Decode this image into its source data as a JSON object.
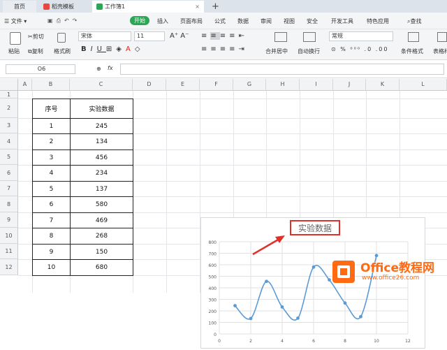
{
  "tabs": [
    {
      "label": "首页"
    },
    {
      "label": "稻壳模板"
    },
    {
      "label": "工作簿1"
    }
  ],
  "new_tab": "+",
  "menu": {
    "file": "文件",
    "start": "开始",
    "items": [
      "插入",
      "页面布局",
      "公式",
      "数据",
      "审阅",
      "视图",
      "安全",
      "开发工具",
      "特色应用"
    ],
    "search": "查找"
  },
  "ribbon": {
    "paste": "粘贴",
    "cut": "剪切",
    "copy": "复制",
    "format_painter": "格式刷",
    "font": "宋体",
    "size": "11",
    "merge": "合并居中",
    "wrap": "自动换行",
    "number_format": "常规",
    "conditional": "条件格式",
    "table_style": "表格样"
  },
  "formula": {
    "cell_ref": "O6",
    "fx": "fx"
  },
  "columns": [
    "A",
    "B",
    "C",
    "D",
    "E",
    "F",
    "G",
    "H",
    "I",
    "J",
    "K",
    "L"
  ],
  "rows": [
    "1",
    "2",
    "3",
    "4",
    "5",
    "6",
    "7",
    "8",
    "9",
    "10",
    "11",
    "12"
  ],
  "table": {
    "header": [
      "序号",
      "实验数据"
    ],
    "rows": [
      [
        "1",
        "245"
      ],
      [
        "2",
        "134"
      ],
      [
        "3",
        "456"
      ],
      [
        "4",
        "234"
      ],
      [
        "5",
        "137"
      ],
      [
        "6",
        "580"
      ],
      [
        "7",
        "469"
      ],
      [
        "8",
        "268"
      ],
      [
        "9",
        "150"
      ],
      [
        "10",
        "680"
      ]
    ]
  },
  "chart_data": {
    "type": "scatter",
    "title": "实验数据",
    "x": [
      1,
      2,
      3,
      4,
      5,
      6,
      7,
      8,
      9,
      10
    ],
    "y": [
      245,
      134,
      456,
      234,
      137,
      580,
      469,
      268,
      150,
      680
    ],
    "xlim": [
      0,
      12
    ],
    "ylim": [
      0,
      800
    ],
    "xticks": [
      "0",
      "2",
      "4",
      "6",
      "8",
      "10",
      "12"
    ],
    "yticks": [
      "0",
      "100",
      "200",
      "300",
      "400",
      "500",
      "600",
      "700",
      "800"
    ],
    "grid": true,
    "smooth": true,
    "line_color": "#5b9bd5"
  },
  "watermark": {
    "brand": "Office教程网",
    "url": "www.office26.com"
  }
}
